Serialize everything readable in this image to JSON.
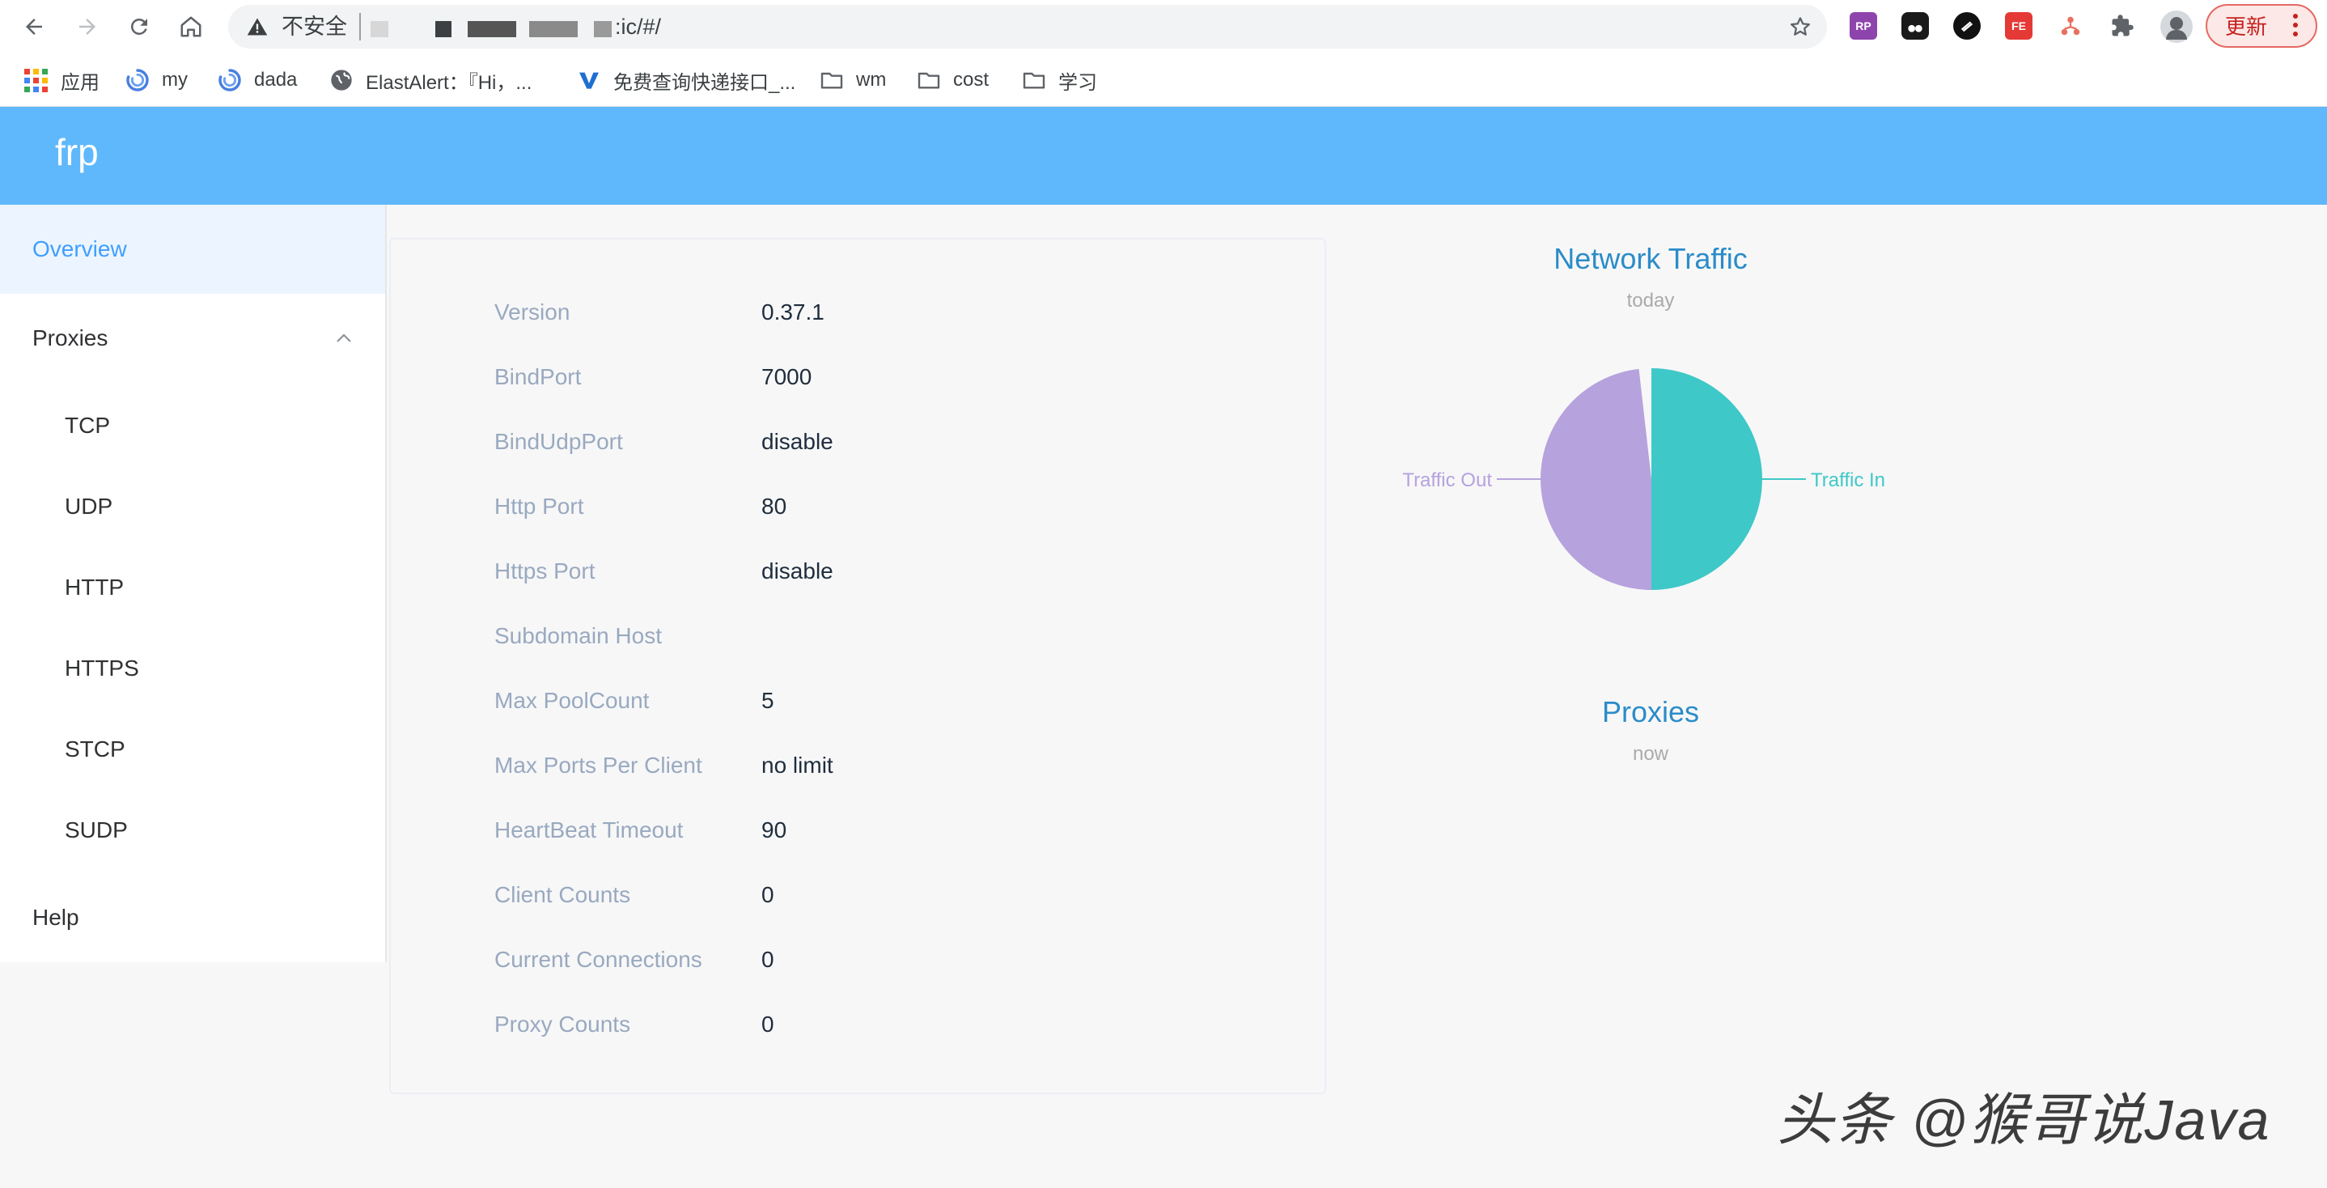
{
  "browser": {
    "security_label": "不安全",
    "url_suffix": ":ic/#/",
    "update_label": "更新",
    "extensions": [
      "RP",
      "FE"
    ],
    "bookmarks": [
      {
        "label": "应用",
        "icon": "apps-grid-icon"
      },
      {
        "label": "my",
        "icon": "spinner-icon"
      },
      {
        "label": "dada",
        "icon": "spinner-icon"
      },
      {
        "label": "ElastAlert：『Hi，...",
        "icon": "globe-icon"
      },
      {
        "label": "免费查询快递接口_...",
        "icon": "v-logo-icon"
      },
      {
        "label": "wm",
        "icon": "folder-icon"
      },
      {
        "label": "cost",
        "icon": "folder-icon"
      },
      {
        "label": "学习",
        "icon": "folder-icon"
      }
    ]
  },
  "app": {
    "title": "frp"
  },
  "sidebar": {
    "overview": "Overview",
    "proxies": "Proxies",
    "proxy_types": [
      "TCP",
      "UDP",
      "HTTP",
      "HTTPS",
      "STCP",
      "SUDP"
    ],
    "help": "Help"
  },
  "info": {
    "rows": [
      {
        "key": "Version",
        "value": "0.37.1"
      },
      {
        "key": "BindPort",
        "value": "7000"
      },
      {
        "key": "BindUdpPort",
        "value": "disable"
      },
      {
        "key": "Http Port",
        "value": "80"
      },
      {
        "key": "Https Port",
        "value": "disable"
      },
      {
        "key": "Subdomain Host",
        "value": ""
      },
      {
        "key": "Max PoolCount",
        "value": "5"
      },
      {
        "key": "Max Ports Per Client",
        "value": "no limit"
      },
      {
        "key": "HeartBeat Timeout",
        "value": "90"
      },
      {
        "key": "Client Counts",
        "value": "0"
      },
      {
        "key": "Current Connections",
        "value": "0"
      },
      {
        "key": "Proxy Counts",
        "value": "0"
      }
    ]
  },
  "charts": {
    "traffic": {
      "title": "Network Traffic",
      "subtitle": "today"
    },
    "proxies": {
      "title": "Proxies",
      "subtitle": "now"
    }
  },
  "chart_data": {
    "type": "pie",
    "title": "Network Traffic",
    "subtitle": "today",
    "slices": [
      {
        "name": "Traffic In",
        "value": 50.0,
        "color": "#3ec8c7"
      },
      {
        "name": "Traffic Out",
        "value": 48.2,
        "color": "#b6a2dd"
      }
    ]
  },
  "watermark": "头条 @猴哥说Java"
}
